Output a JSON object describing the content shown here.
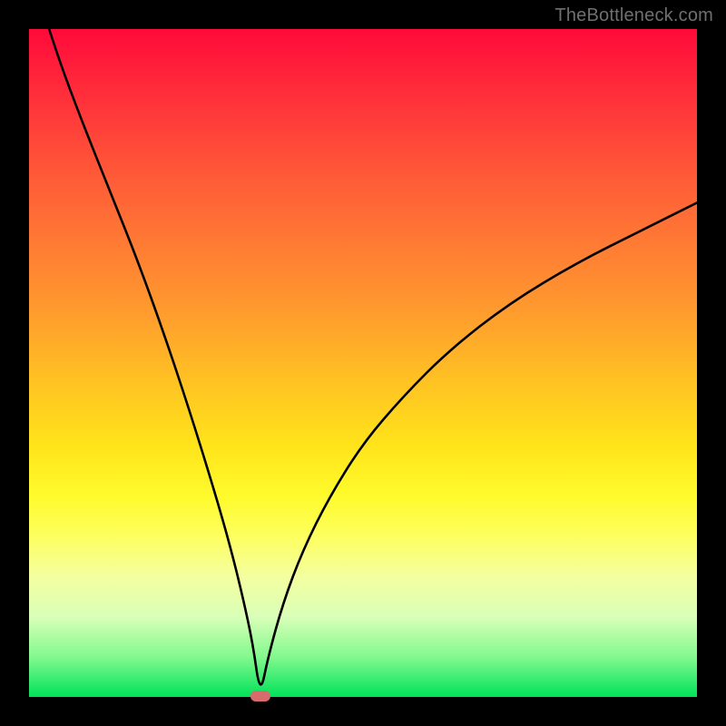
{
  "watermark": "TheBottleneck.com",
  "chart_data": {
    "type": "line",
    "title": "",
    "xlabel": "",
    "ylabel": "",
    "xlim": [
      0,
      100
    ],
    "ylim": [
      0,
      100
    ],
    "grid": false,
    "series": [
      {
        "name": "bottleneck-curve",
        "x": [
          3,
          5,
          8,
          12,
          16,
          20,
          24,
          28,
          30,
          32,
          33.5,
          34.6,
          35.8,
          38,
          41,
          45,
          50,
          56,
          63,
          72,
          82,
          92,
          100
        ],
        "y": [
          100,
          94,
          86,
          76,
          66,
          55,
          43,
          30,
          23,
          15,
          8,
          0.2,
          6,
          14,
          22,
          30,
          38,
          45,
          52,
          59,
          65,
          70,
          74
        ]
      }
    ],
    "annotations": [
      {
        "name": "minimum-marker",
        "x": 34.6,
        "y": 0.2
      }
    ],
    "background": {
      "type": "vertical-gradient",
      "stops": [
        {
          "pos": 0,
          "color": "#ff0a3a"
        },
        {
          "pos": 22,
          "color": "#ff5a38"
        },
        {
          "pos": 52,
          "color": "#ffbf24"
        },
        {
          "pos": 70,
          "color": "#fffb2c"
        },
        {
          "pos": 100,
          "color": "#00e25a"
        }
      ]
    }
  }
}
